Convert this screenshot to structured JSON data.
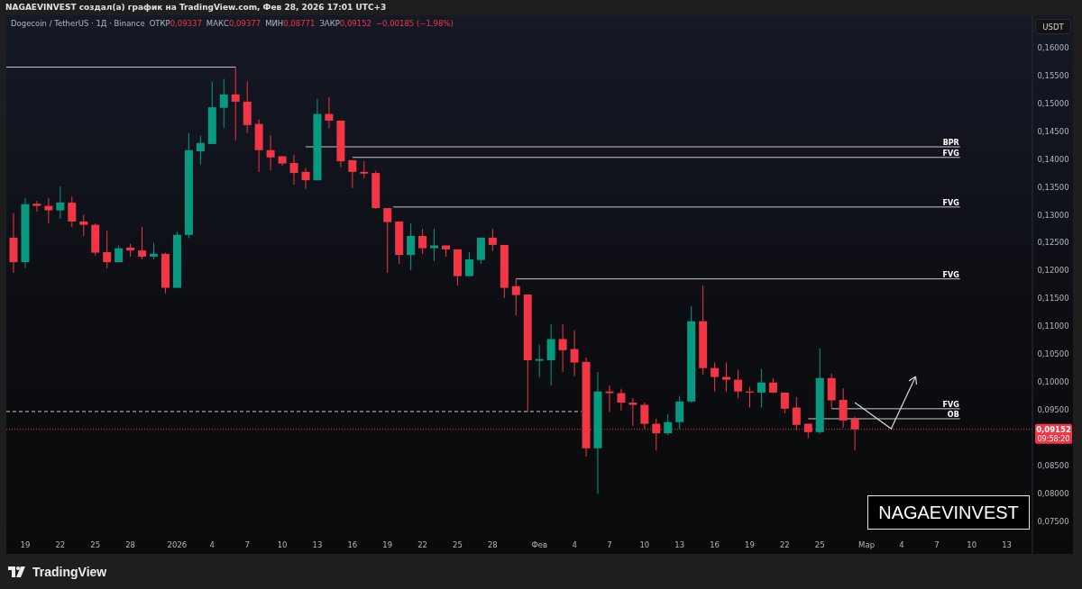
{
  "header": {
    "text": "NAGAEVINVEST создал(а) график на TradingView.com, Фев 28, 2026 17:01 UTC+3"
  },
  "legend": {
    "symbol": "Dogecoin / TetherUS · 1Д · Binance",
    "fields": [
      {
        "label": "ОТКР",
        "value": "0,09337"
      },
      {
        "label": "МАКС",
        "value": "0,09377"
      },
      {
        "label": "МИН",
        "value": "0,08771"
      },
      {
        "label": "ЗАКР",
        "value": "0,09152"
      }
    ],
    "change": "−0,00185 (−1,98%)"
  },
  "currency_button": "USDT",
  "price_axis": [
    "0,16000",
    "0,15500",
    "0,15000",
    "0,14500",
    "0,14000",
    "0,13500",
    "0,13000",
    "0,12500",
    "0,12000",
    "0,11500",
    "0,11000",
    "0,10500",
    "0,10000",
    "0,09500",
    "0,08500",
    "0,08000",
    "0,07500"
  ],
  "time_axis": [
    "19",
    "22",
    "25",
    "28",
    "2026",
    "4",
    "7",
    "10",
    "13",
    "16",
    "19",
    "22",
    "25",
    "28",
    "Фев",
    "4",
    "7",
    "10",
    "13",
    "16",
    "19",
    "22",
    "25",
    "Мар",
    "4",
    "7",
    "10",
    "13"
  ],
  "level_labels": [
    "BPR",
    "FVG",
    "FVG",
    "FVG",
    "FVG",
    "OB"
  ],
  "last_price": {
    "price": "0,09152",
    "countdown": "09:58:20"
  },
  "text_box": "NAGAEVINVEST",
  "footer": {
    "brand": "TradingView"
  }
}
